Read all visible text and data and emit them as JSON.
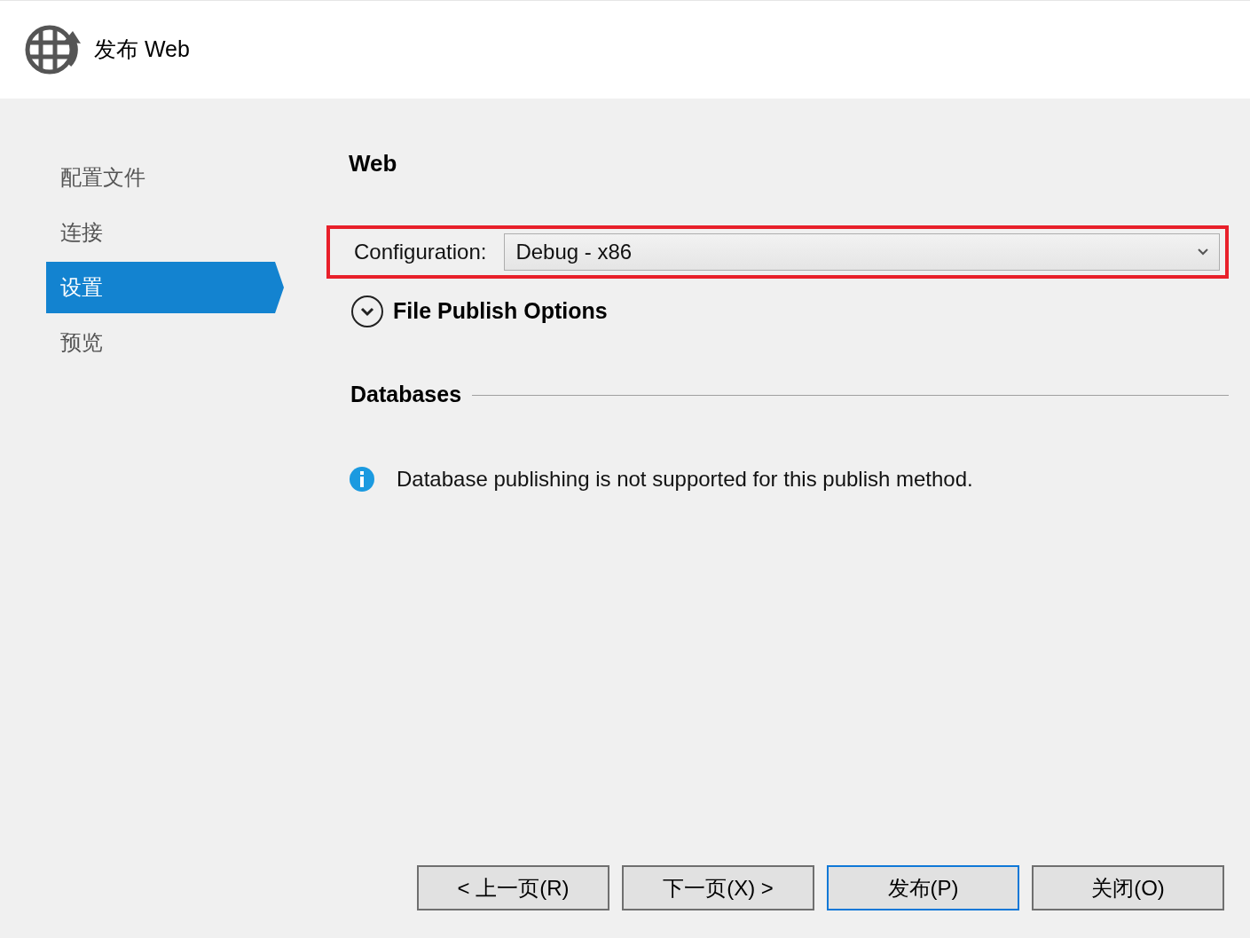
{
  "window": {
    "title": "发布 Web"
  },
  "sidebar": {
    "items": [
      {
        "label": "配置文件",
        "selected": false
      },
      {
        "label": "连接",
        "selected": false
      },
      {
        "label": "设置",
        "selected": true
      },
      {
        "label": "预览",
        "selected": false
      }
    ]
  },
  "content": {
    "heading": "Web",
    "configuration": {
      "label": "Configuration:",
      "value": "Debug - x86",
      "highlighted": true
    },
    "file_publish_options": {
      "label": "File Publish Options",
      "expanded": false
    },
    "databases": {
      "heading": "Databases",
      "message": "Database publishing is not supported for this publish method."
    }
  },
  "buttons": [
    {
      "label": "< 上一页(R)",
      "default": false
    },
    {
      "label": "下一页(X) >",
      "default": false
    },
    {
      "label": "发布(P)",
      "default": true
    },
    {
      "label": "关闭(O)",
      "default": false
    }
  ]
}
